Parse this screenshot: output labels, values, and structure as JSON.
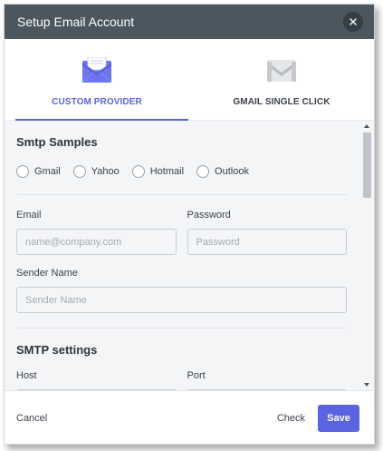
{
  "dialog": {
    "title": "Setup Email Account"
  },
  "tabs": [
    {
      "label": "CUSTOM PROVIDER",
      "icon": "envelope-icon",
      "active": true
    },
    {
      "label": "GMAIL SINGLE CLICK",
      "icon": "gmail-icon",
      "active": false
    }
  ],
  "smtp_samples": {
    "title": "Smtp Samples",
    "options": [
      "Gmail",
      "Yahoo",
      "Hotmail",
      "Outlook"
    ]
  },
  "fields": {
    "email": {
      "label": "Email",
      "placeholder": "name@company.com",
      "value": ""
    },
    "password": {
      "label": "Password",
      "placeholder": "Password",
      "value": ""
    },
    "sender_name": {
      "label": "Sender Name",
      "placeholder": "Sender Name",
      "value": ""
    }
  },
  "smtp_settings": {
    "title": "SMTP settings",
    "host_label": "Host",
    "port_label": "Port"
  },
  "footer": {
    "cancel_label": "Cancel",
    "check_label": "Check",
    "save_label": "Save"
  },
  "colors": {
    "accent": "#5b63e0",
    "header_bg": "#4b565f",
    "content_bg": "#f4f5f7"
  }
}
